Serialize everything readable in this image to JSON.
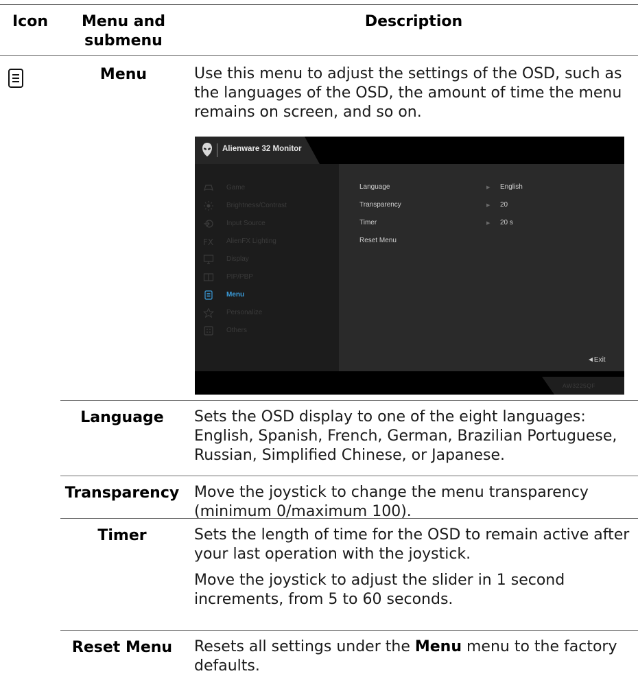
{
  "header": {
    "icon": "Icon",
    "menu_line1": "Menu and",
    "menu_line2": "submenu",
    "description": "Description"
  },
  "menu_row": {
    "icon": "menu-list-icon",
    "name": "Menu",
    "description": "Use this menu to adjust the settings of the OSD, such as the languages of the OSD, the amount of time the menu remains on screen, and so on."
  },
  "osd": {
    "title": "Alienware 32 Monitor",
    "model": "AW3225QF",
    "exit": "◄Exit",
    "nav": [
      {
        "label": "Game",
        "icon": "gamepad-icon"
      },
      {
        "label": "Brightness/Contrast",
        "icon": "brightness-icon"
      },
      {
        "label": "Input Source",
        "icon": "input-source-icon"
      },
      {
        "label": "AlienFX Lighting",
        "icon": "fx-icon"
      },
      {
        "label": "Display",
        "icon": "display-icon"
      },
      {
        "label": "PIP/PBP",
        "icon": "pip-icon"
      },
      {
        "label": "Menu",
        "icon": "menu-icon",
        "active": true
      },
      {
        "label": "Personalize",
        "icon": "star-icon"
      },
      {
        "label": "Others",
        "icon": "others-icon"
      }
    ],
    "settings": [
      {
        "label": "Language",
        "value": "English"
      },
      {
        "label": "Transparency",
        "value": "20"
      },
      {
        "label": "Timer",
        "value": "20 s"
      },
      {
        "label": "Reset Menu",
        "value": ""
      }
    ]
  },
  "rows": {
    "language": {
      "name": "Language",
      "description": "Sets the OSD display to one of the eight languages: English, Spanish, French, German, Brazilian Portuguese, Russian, Simplified Chinese, or Japanese."
    },
    "transparency": {
      "name": "Transparency",
      "description": "Move the joystick to change the menu transparency (minimum 0/maximum 100)."
    },
    "timer": {
      "name": "Timer",
      "description1": "Sets the length of time for the OSD to remain active after your last operation with the joystick.",
      "description2": "Move the joystick to adjust the slider in 1 second increments, from 5 to 60 seconds."
    },
    "reset_menu": {
      "name": "Reset Menu",
      "desc_pre": "Resets all settings under the ",
      "desc_bold": "Menu",
      "desc_post": " menu to the factory defaults."
    }
  }
}
